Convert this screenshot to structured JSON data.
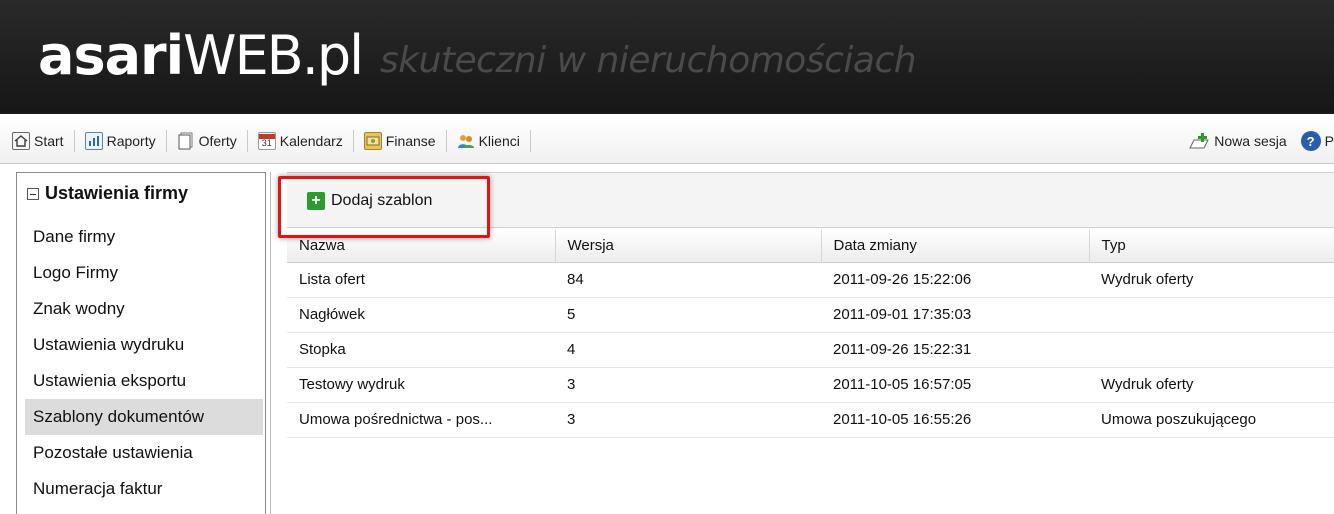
{
  "brand": {
    "name_bold": "asari",
    "name_light": "WEB.pl",
    "tagline": "skuteczni w nieruchomościach"
  },
  "toolbar": {
    "items": [
      {
        "label": "Start",
        "icon": "home-icon"
      },
      {
        "label": "Raporty",
        "icon": "report-icon"
      },
      {
        "label": "Oferty",
        "icon": "offers-icon"
      },
      {
        "label": "Kalendarz",
        "icon": "calendar-icon"
      },
      {
        "label": "Finanse",
        "icon": "finance-icon"
      },
      {
        "label": "Klienci",
        "icon": "clients-icon"
      }
    ],
    "new_session": "Nowa sesja",
    "help_partial": "P",
    "calendar_day": "31"
  },
  "sidebar": {
    "title": "Ustawienia firmy",
    "items": [
      {
        "label": "Dane firmy"
      },
      {
        "label": "Logo Firmy"
      },
      {
        "label": "Znak wodny"
      },
      {
        "label": "Ustawienia wydruku"
      },
      {
        "label": "Ustawienia eksportu"
      },
      {
        "label": "Szablony dokumentów"
      },
      {
        "label": "Pozostałe ustawienia"
      },
      {
        "label": "Numeracja faktur"
      }
    ],
    "active_index": 5
  },
  "main": {
    "add_button": "Dodaj szablon",
    "table": {
      "headers": [
        "Nazwa",
        "Wersja",
        "Data zmiany",
        "Typ"
      ],
      "rows": [
        [
          "Lista ofert",
          "84",
          "2011-09-26 15:22:06",
          "Wydruk oferty"
        ],
        [
          "Nagłówek",
          "5",
          "2011-09-01 17:35:03",
          ""
        ],
        [
          "Stopka",
          "4",
          "2011-09-26 15:22:31",
          ""
        ],
        [
          "Testowy wydruk",
          "3",
          "2011-10-05 16:57:05",
          "Wydruk oferty"
        ],
        [
          "Umowa pośrednictwa - pos...",
          "3",
          "2011-10-05 16:55:26",
          "Umowa poszukującego"
        ]
      ]
    }
  },
  "colors": {
    "header_bg": "#1a1a1a",
    "highlight": "#e01414",
    "add_icon": "#2e9b2e",
    "help_icon": "#2a5db0"
  }
}
